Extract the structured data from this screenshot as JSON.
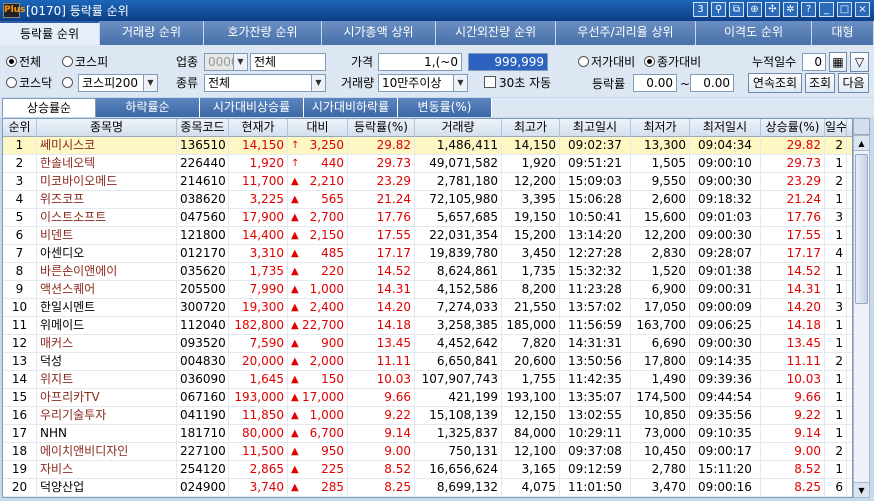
{
  "window": {
    "logo": "Plus",
    "title": "[0170] 등락률 순위",
    "icon_box_label": "3"
  },
  "tabs": [
    "등락률 순위",
    "거래량 순위",
    "호가잔량 순위",
    "시가총액 상위",
    "시간외잔량 순위",
    "우선주/괴리율 상위",
    "이격도 순위",
    "대형"
  ],
  "filters": {
    "market_all": "전체",
    "kospi": "코스피",
    "kosdaq": "코스닥",
    "kospi200": "코스피200",
    "industry_label": "업종",
    "industry_code": "0000",
    "industry_name": "전체",
    "type_label": "종류",
    "type_value": "전체",
    "price_label": "가격",
    "price_min": "1,(~0",
    "price_max": "999,999",
    "volume_label": "거래량",
    "volume_value": "10만주이상",
    "auto_label": "30초 자동",
    "vs_low": "저가대비",
    "vs_close": "종가대비",
    "cum_days_label": "누적일수",
    "cum_days": "0",
    "rate_label": "등락률",
    "rate_min": "0.00",
    "rate_tilde": "~",
    "rate_max": "0.00",
    "btn_continuous": "연속조회",
    "btn_query": "조회",
    "btn_next": "다음"
  },
  "subtabs": [
    "상승률순",
    "하락률순",
    "시가대비상승률",
    "시가대비하락률",
    "변동률(%)"
  ],
  "columns": [
    "순위",
    "종목명",
    "종목코드",
    "현재가",
    "대비",
    "등락률(%)",
    "거래량",
    "최고가",
    "최고일시",
    "최저가",
    "최저일시",
    "상승률(%)",
    "일수"
  ],
  "rows": [
    {
      "rank": "1",
      "name": "쎄미시스코",
      "code": "136510",
      "price": "14,150",
      "sym": "↑",
      "chg": "3,250",
      "rate": "29.82",
      "vol": "1,486,411",
      "high": "14,150",
      "high_t": "09:02:37",
      "low": "13,300",
      "low_t": "09:04:34",
      "up": "29.82",
      "days": "2"
    },
    {
      "rank": "2",
      "name": "한솔네오텍",
      "code": "226440",
      "price": "1,920",
      "sym": "↑",
      "chg": "440",
      "rate": "29.73",
      "vol": "49,071,582",
      "high": "1,920",
      "high_t": "09:51:21",
      "low": "1,505",
      "low_t": "09:00:10",
      "up": "29.73",
      "days": "1"
    },
    {
      "rank": "3",
      "name": "미코바이오메드",
      "code": "214610",
      "price": "11,700",
      "sym": "▲",
      "chg": "2,210",
      "rate": "23.29",
      "vol": "2,781,180",
      "high": "12,200",
      "high_t": "15:09:03",
      "low": "9,550",
      "low_t": "09:00:30",
      "up": "23.29",
      "days": "2"
    },
    {
      "rank": "4",
      "name": "위즈코프",
      "code": "038620",
      "price": "3,225",
      "sym": "▲",
      "chg": "565",
      "rate": "21.24",
      "vol": "72,105,980",
      "high": "3,395",
      "high_t": "15:06:28",
      "low": "2,600",
      "low_t": "09:18:32",
      "up": "21.24",
      "days": "1"
    },
    {
      "rank": "5",
      "name": "이스트소프트",
      "code": "047560",
      "price": "17,900",
      "sym": "▲",
      "chg": "2,700",
      "rate": "17.76",
      "vol": "5,657,685",
      "high": "19,150",
      "high_t": "10:50:41",
      "low": "15,600",
      "low_t": "09:01:03",
      "up": "17.76",
      "days": "3"
    },
    {
      "rank": "6",
      "name": "비덴트",
      "code": "121800",
      "price": "14,400",
      "sym": "▲",
      "chg": "2,150",
      "rate": "17.55",
      "vol": "22,031,354",
      "high": "15,200",
      "high_t": "13:14:20",
      "low": "12,200",
      "low_t": "09:00:30",
      "up": "17.55",
      "days": "1"
    },
    {
      "rank": "7",
      "name": "아센디오",
      "code": "012170",
      "price": "3,310",
      "sym": "▲",
      "chg": "485",
      "rate": "17.17",
      "vol": "19,839,780",
      "high": "3,450",
      "high_t": "12:27:28",
      "low": "2,830",
      "low_t": "09:28:07",
      "up": "17.17",
      "days": "4"
    },
    {
      "rank": "8",
      "name": "바른손이앤에이",
      "code": "035620",
      "price": "1,735",
      "sym": "▲",
      "chg": "220",
      "rate": "14.52",
      "vol": "8,624,861",
      "high": "1,735",
      "high_t": "15:32:32",
      "low": "1,520",
      "low_t": "09:01:38",
      "up": "14.52",
      "days": "1"
    },
    {
      "rank": "9",
      "name": "액션스퀘어",
      "code": "205500",
      "price": "7,990",
      "sym": "▲",
      "chg": "1,000",
      "rate": "14.31",
      "vol": "4,152,586",
      "high": "8,200",
      "high_t": "11:23:28",
      "low": "6,900",
      "low_t": "09:00:31",
      "up": "14.31",
      "days": "1"
    },
    {
      "rank": "10",
      "name": "한일시멘트",
      "code": "300720",
      "price": "19,300",
      "sym": "▲",
      "chg": "2,400",
      "rate": "14.20",
      "vol": "7,274,033",
      "high": "21,550",
      "high_t": "13:57:02",
      "low": "17,050",
      "low_t": "09:00:09",
      "up": "14.20",
      "days": "3"
    },
    {
      "rank": "11",
      "name": "위메이드",
      "code": "112040",
      "price": "182,800",
      "sym": "▲",
      "chg": "22,700",
      "rate": "14.18",
      "vol": "3,258,385",
      "high": "185,000",
      "high_t": "11:56:59",
      "low": "163,700",
      "low_t": "09:06:25",
      "up": "14.18",
      "days": "1"
    },
    {
      "rank": "12",
      "name": "매커스",
      "code": "093520",
      "price": "7,590",
      "sym": "▲",
      "chg": "900",
      "rate": "13.45",
      "vol": "4,452,642",
      "high": "7,820",
      "high_t": "14:31:31",
      "low": "6,690",
      "low_t": "09:00:30",
      "up": "13.45",
      "days": "1"
    },
    {
      "rank": "13",
      "name": "덕성",
      "code": "004830",
      "price": "20,000",
      "sym": "▲",
      "chg": "2,000",
      "rate": "11.11",
      "vol": "6,650,841",
      "high": "20,600",
      "high_t": "13:50:56",
      "low": "17,800",
      "low_t": "09:14:35",
      "up": "11.11",
      "days": "2"
    },
    {
      "rank": "14",
      "name": "위지트",
      "code": "036090",
      "price": "1,645",
      "sym": "▲",
      "chg": "150",
      "rate": "10.03",
      "vol": "107,907,743",
      "high": "1,755",
      "high_t": "11:42:35",
      "low": "1,490",
      "low_t": "09:39:36",
      "up": "10.03",
      "days": "1"
    },
    {
      "rank": "15",
      "name": "아프리카TV",
      "code": "067160",
      "price": "193,000",
      "sym": "▲",
      "chg": "17,000",
      "rate": "9.66",
      "vol": "421,199",
      "high": "193,100",
      "high_t": "13:35:07",
      "low": "174,500",
      "low_t": "09:44:54",
      "up": "9.66",
      "days": "1"
    },
    {
      "rank": "16",
      "name": "우리기술투자",
      "code": "041190",
      "price": "11,850",
      "sym": "▲",
      "chg": "1,000",
      "rate": "9.22",
      "vol": "15,108,139",
      "high": "12,150",
      "high_t": "13:02:55",
      "low": "10,850",
      "low_t": "09:35:56",
      "up": "9.22",
      "days": "1"
    },
    {
      "rank": "17",
      "name": "NHN",
      "code": "181710",
      "price": "80,000",
      "sym": "▲",
      "chg": "6,700",
      "rate": "9.14",
      "vol": "1,325,837",
      "high": "84,000",
      "high_t": "10:29:11",
      "low": "73,000",
      "low_t": "09:10:35",
      "up": "9.14",
      "days": "1"
    },
    {
      "rank": "18",
      "name": "에이치앤비디자인",
      "code": "227100",
      "price": "11,500",
      "sym": "▲",
      "chg": "950",
      "rate": "9.00",
      "vol": "750,131",
      "high": "12,100",
      "high_t": "09:37:08",
      "low": "10,450",
      "low_t": "09:00:17",
      "up": "9.00",
      "days": "2"
    },
    {
      "rank": "19",
      "name": "자비스",
      "code": "254120",
      "price": "2,865",
      "sym": "▲",
      "chg": "225",
      "rate": "8.52",
      "vol": "16,656,624",
      "high": "3,165",
      "high_t": "09:12:59",
      "low": "2,780",
      "low_t": "15:11:20",
      "up": "8.52",
      "days": "1"
    },
    {
      "rank": "20",
      "name": "덕양산업",
      "code": "024900",
      "price": "3,740",
      "sym": "▲",
      "chg": "285",
      "rate": "8.25",
      "vol": "8,699,132",
      "high": "4,075",
      "high_t": "11:01:50",
      "low": "3,470",
      "low_t": "09:00:16",
      "up": "8.25",
      "days": "6"
    }
  ],
  "name_colors": {
    "highlight": "#8b2a1f",
    "plain": "#000000"
  },
  "accent": {
    "up_red": "#e00000",
    "selected_row": "#fdf7c3"
  }
}
